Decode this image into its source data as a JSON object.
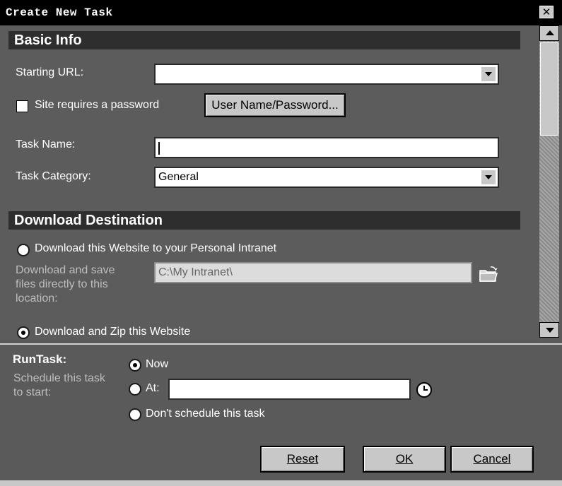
{
  "window": {
    "title": "Create New Task",
    "close_glyph": "✕"
  },
  "basic_info": {
    "heading": "Basic Info",
    "starting_url": {
      "label": "Starting URL:",
      "value": ""
    },
    "password": {
      "label": "Site requires a password",
      "checked": false,
      "button_label": "User Name/Password..."
    },
    "task_name": {
      "label": "Task Name:",
      "value": ""
    },
    "task_category": {
      "label": "Task Category:",
      "value": "General"
    }
  },
  "download_destination": {
    "heading": "Download Destination",
    "option_intranet": {
      "label": "Download this Website to your Personal Intranet",
      "selected": false
    },
    "location": {
      "label_line1": "Download and save",
      "label_line2": "files directly to this",
      "label_line3": "location:",
      "value": "C:\\My Intranet\\"
    },
    "option_zip": {
      "label": "Download and Zip this Website",
      "selected": true
    },
    "folder_icon": "folder-open-icon"
  },
  "run_task": {
    "heading": "RunTask:",
    "desc_line1": "Schedule this task",
    "desc_line2": "to start:",
    "option_now": {
      "label": "Now",
      "selected": true
    },
    "option_at": {
      "label": "At:",
      "selected": false,
      "value": ""
    },
    "option_none": {
      "label": "Don't schedule this task",
      "selected": false
    },
    "clock_icon": "clock-icon"
  },
  "buttons": {
    "reset": "Reset",
    "ok": "OK",
    "cancel": "Cancel"
  },
  "colors": {
    "background": "#5a5a5a",
    "section_bar": "#2e2e2e",
    "button_face": "#c8c8c8"
  }
}
